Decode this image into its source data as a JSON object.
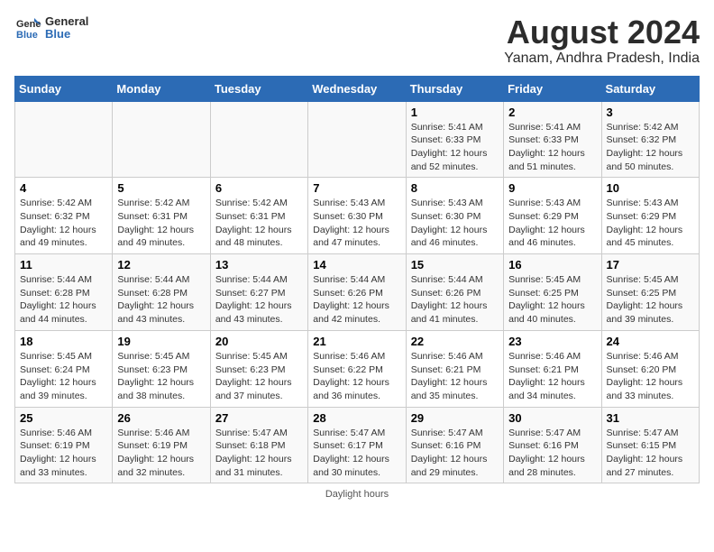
{
  "logo": {
    "line1": "General",
    "line2": "Blue"
  },
  "title": "August 2024",
  "subtitle": "Yanam, Andhra Pradesh, India",
  "days_of_week": [
    "Sunday",
    "Monday",
    "Tuesday",
    "Wednesday",
    "Thursday",
    "Friday",
    "Saturday"
  ],
  "footer": "Daylight hours",
  "weeks": [
    [
      {
        "day": "",
        "info": ""
      },
      {
        "day": "",
        "info": ""
      },
      {
        "day": "",
        "info": ""
      },
      {
        "day": "",
        "info": ""
      },
      {
        "day": "1",
        "info": "Sunrise: 5:41 AM\nSunset: 6:33 PM\nDaylight: 12 hours\nand 52 minutes."
      },
      {
        "day": "2",
        "info": "Sunrise: 5:41 AM\nSunset: 6:33 PM\nDaylight: 12 hours\nand 51 minutes."
      },
      {
        "day": "3",
        "info": "Sunrise: 5:42 AM\nSunset: 6:32 PM\nDaylight: 12 hours\nand 50 minutes."
      }
    ],
    [
      {
        "day": "4",
        "info": "Sunrise: 5:42 AM\nSunset: 6:32 PM\nDaylight: 12 hours\nand 49 minutes."
      },
      {
        "day": "5",
        "info": "Sunrise: 5:42 AM\nSunset: 6:31 PM\nDaylight: 12 hours\nand 49 minutes."
      },
      {
        "day": "6",
        "info": "Sunrise: 5:42 AM\nSunset: 6:31 PM\nDaylight: 12 hours\nand 48 minutes."
      },
      {
        "day": "7",
        "info": "Sunrise: 5:43 AM\nSunset: 6:30 PM\nDaylight: 12 hours\nand 47 minutes."
      },
      {
        "day": "8",
        "info": "Sunrise: 5:43 AM\nSunset: 6:30 PM\nDaylight: 12 hours\nand 46 minutes."
      },
      {
        "day": "9",
        "info": "Sunrise: 5:43 AM\nSunset: 6:29 PM\nDaylight: 12 hours\nand 46 minutes."
      },
      {
        "day": "10",
        "info": "Sunrise: 5:43 AM\nSunset: 6:29 PM\nDaylight: 12 hours\nand 45 minutes."
      }
    ],
    [
      {
        "day": "11",
        "info": "Sunrise: 5:44 AM\nSunset: 6:28 PM\nDaylight: 12 hours\nand 44 minutes."
      },
      {
        "day": "12",
        "info": "Sunrise: 5:44 AM\nSunset: 6:28 PM\nDaylight: 12 hours\nand 43 minutes."
      },
      {
        "day": "13",
        "info": "Sunrise: 5:44 AM\nSunset: 6:27 PM\nDaylight: 12 hours\nand 43 minutes."
      },
      {
        "day": "14",
        "info": "Sunrise: 5:44 AM\nSunset: 6:26 PM\nDaylight: 12 hours\nand 42 minutes."
      },
      {
        "day": "15",
        "info": "Sunrise: 5:44 AM\nSunset: 6:26 PM\nDaylight: 12 hours\nand 41 minutes."
      },
      {
        "day": "16",
        "info": "Sunrise: 5:45 AM\nSunset: 6:25 PM\nDaylight: 12 hours\nand 40 minutes."
      },
      {
        "day": "17",
        "info": "Sunrise: 5:45 AM\nSunset: 6:25 PM\nDaylight: 12 hours\nand 39 minutes."
      }
    ],
    [
      {
        "day": "18",
        "info": "Sunrise: 5:45 AM\nSunset: 6:24 PM\nDaylight: 12 hours\nand 39 minutes."
      },
      {
        "day": "19",
        "info": "Sunrise: 5:45 AM\nSunset: 6:23 PM\nDaylight: 12 hours\nand 38 minutes."
      },
      {
        "day": "20",
        "info": "Sunrise: 5:45 AM\nSunset: 6:23 PM\nDaylight: 12 hours\nand 37 minutes."
      },
      {
        "day": "21",
        "info": "Sunrise: 5:46 AM\nSunset: 6:22 PM\nDaylight: 12 hours\nand 36 minutes."
      },
      {
        "day": "22",
        "info": "Sunrise: 5:46 AM\nSunset: 6:21 PM\nDaylight: 12 hours\nand 35 minutes."
      },
      {
        "day": "23",
        "info": "Sunrise: 5:46 AM\nSunset: 6:21 PM\nDaylight: 12 hours\nand 34 minutes."
      },
      {
        "day": "24",
        "info": "Sunrise: 5:46 AM\nSunset: 6:20 PM\nDaylight: 12 hours\nand 33 minutes."
      }
    ],
    [
      {
        "day": "25",
        "info": "Sunrise: 5:46 AM\nSunset: 6:19 PM\nDaylight: 12 hours\nand 33 minutes."
      },
      {
        "day": "26",
        "info": "Sunrise: 5:46 AM\nSunset: 6:19 PM\nDaylight: 12 hours\nand 32 minutes."
      },
      {
        "day": "27",
        "info": "Sunrise: 5:47 AM\nSunset: 6:18 PM\nDaylight: 12 hours\nand 31 minutes."
      },
      {
        "day": "28",
        "info": "Sunrise: 5:47 AM\nSunset: 6:17 PM\nDaylight: 12 hours\nand 30 minutes."
      },
      {
        "day": "29",
        "info": "Sunrise: 5:47 AM\nSunset: 6:16 PM\nDaylight: 12 hours\nand 29 minutes."
      },
      {
        "day": "30",
        "info": "Sunrise: 5:47 AM\nSunset: 6:16 PM\nDaylight: 12 hours\nand 28 minutes."
      },
      {
        "day": "31",
        "info": "Sunrise: 5:47 AM\nSunset: 6:15 PM\nDaylight: 12 hours\nand 27 minutes."
      }
    ]
  ]
}
